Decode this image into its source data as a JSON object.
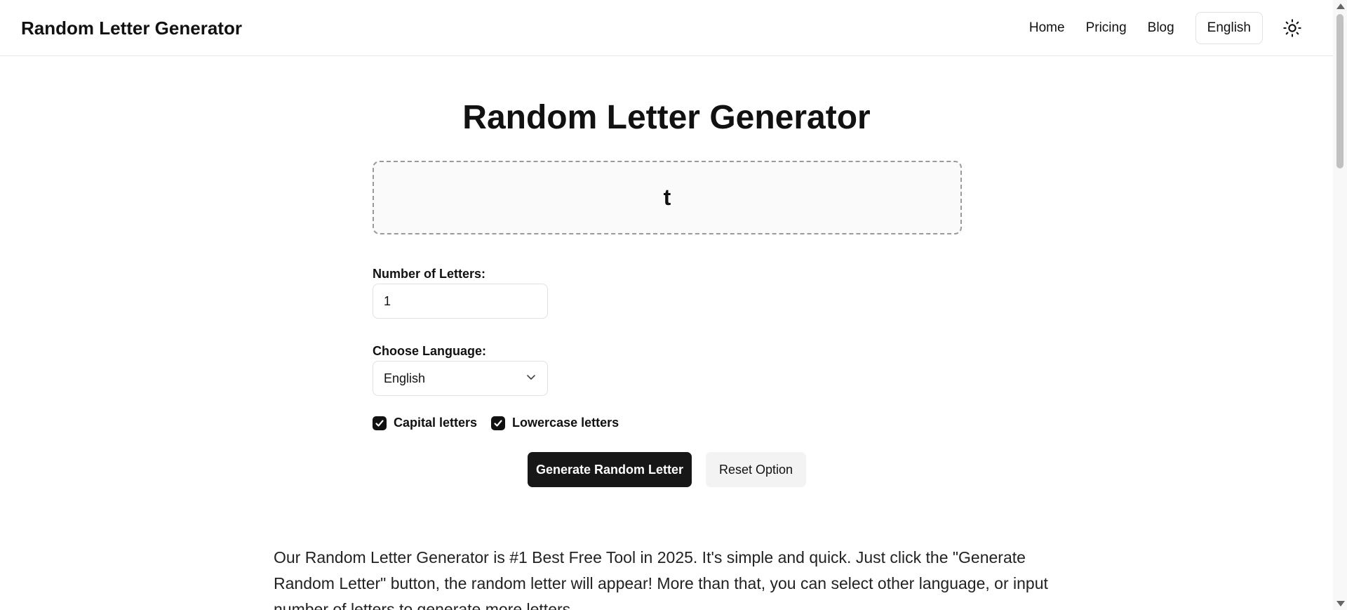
{
  "header": {
    "brand": "Random Letter Generator",
    "nav": {
      "home": "Home",
      "pricing": "Pricing",
      "blog": "Blog",
      "language": "English"
    },
    "theme_icon": "sun-icon"
  },
  "main": {
    "title": "Random Letter Generator",
    "output": "t",
    "number_label": "Number of Letters:",
    "number_value": "1",
    "language_label": "Choose Language:",
    "language_selected": "English",
    "capital_label": "Capital letters",
    "capital_checked": true,
    "lowercase_label": "Lowercase letters",
    "lowercase_checked": true,
    "generate_button": "Generate Random Letter",
    "reset_button": "Reset Option"
  },
  "description": "Our Random Letter Generator is #1 Best Free Tool in 2025. It's simple and quick. Just click the \"Generate Random Letter\" button, the random letter will appear! More than that, you can select other language, or input number of letters to generate more letters.",
  "colors": {
    "primary_button": "#171717",
    "secondary_button": "#f3f3f3",
    "checkbox": "#111111"
  }
}
